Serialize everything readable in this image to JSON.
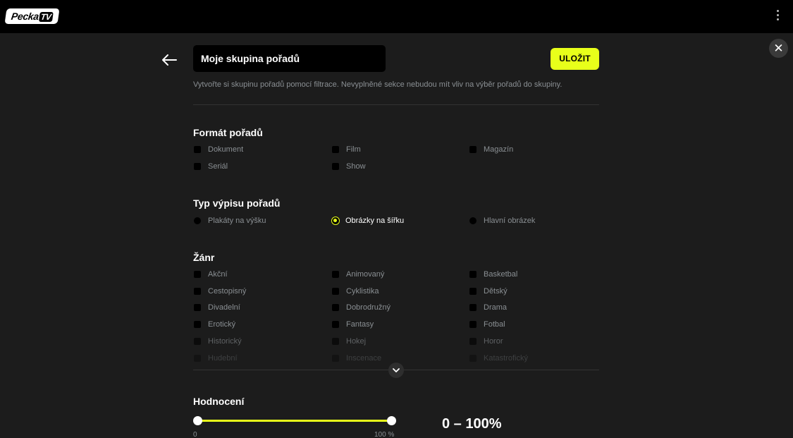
{
  "header": {
    "logo_text": "Pecka",
    "logo_tv": "TV"
  },
  "editor": {
    "name_value": "Moje skupina pořadů",
    "save_label": "ULOŽIT",
    "close_glyph": "✕",
    "description": "Vytvořte si skupinu pořadů pomocí filtrace. Nevyplněné sekce nebudou mít vliv na výběr pořadů do skupiny."
  },
  "format": {
    "title": "Formát pořadů",
    "options": [
      "Dokument",
      "Film",
      "Magazín",
      "Seriál",
      "Show"
    ]
  },
  "listing": {
    "title": "Typ výpisu pořadů",
    "options": [
      "Plakáty na výšku",
      "Obrázky na šířku",
      "Hlavní obrázek"
    ],
    "selected": "Obrázky na šířku"
  },
  "genre": {
    "title": "Žánr",
    "options": [
      "Akční",
      "Animovaný",
      "Basketbal",
      "Cestopisný",
      "Cyklistika",
      "Dětský",
      "Divadelní",
      "Dobrodružný",
      "Drama",
      "Erotický",
      "Fantasy",
      "Fotbal",
      "Historický",
      "Hokej",
      "Horor",
      "Hudební",
      "Inscenace",
      "Katastrofický"
    ]
  },
  "rating": {
    "title": "Hodnocení",
    "min": 0,
    "max": 100,
    "min_label": "0",
    "max_label": "100 %",
    "range_text": "0 – 100%"
  },
  "colors": {
    "accent": "#e8ff1a",
    "background": "#1c1c1c",
    "topbar": "#000000",
    "muted_text": "#8a8f93"
  },
  "icons": [
    "menu-dots-icon",
    "close-icon",
    "back-arrow-icon",
    "chevron-down-icon"
  ]
}
